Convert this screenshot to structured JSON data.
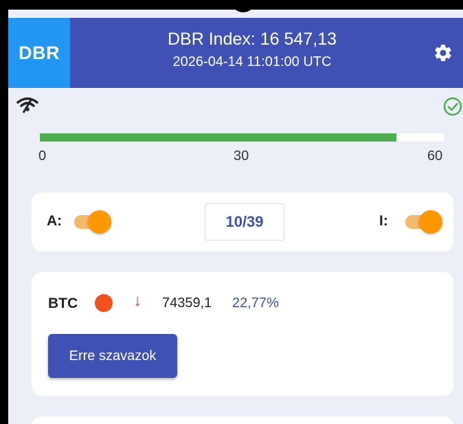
{
  "header": {
    "logo": "DBR",
    "index_line": "DBR Index: 16 547,13",
    "time_line": "2026-04-14 11:01:00 UTC",
    "settings_icon": "gear-icon"
  },
  "status": {
    "connection_icon": "wifi-icon",
    "ok_icon": "check-circle-icon",
    "ok_color": "#4caf50"
  },
  "progress": {
    "value": 53,
    "min": 0,
    "max": 60,
    "fill_color": "#4caf50",
    "ticks": [
      "0",
      "30",
      "60"
    ]
  },
  "controls": {
    "toggle_a_label": "A:",
    "toggle_a_on": true,
    "counter": "10/39",
    "toggle_i_label": "I:",
    "toggle_i_on": true,
    "toggle_color": "#ff9800"
  },
  "coin": {
    "name": "BTC",
    "dot_color": "#f4511e",
    "direction_icon": "arrow-down-icon",
    "price": "74359,1",
    "change": "22,77%",
    "vote_button": "Erre szavazok"
  }
}
